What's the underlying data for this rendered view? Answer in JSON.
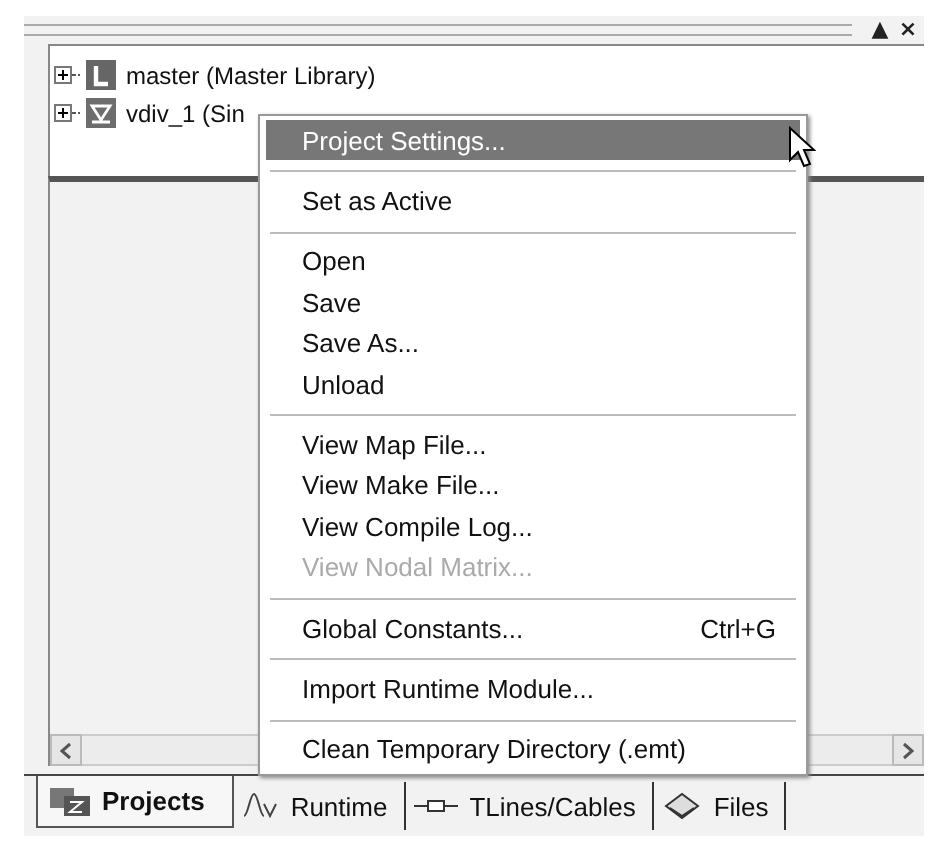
{
  "panel": {
    "header_buttons": [
      "▲",
      "×"
    ]
  },
  "tree": [
    {
      "label": "master (Master Library)",
      "expanded": false
    },
    {
      "label": "vdiv_1 (Sin",
      "expanded": false
    }
  ],
  "context_menu": [
    {
      "kind": "item",
      "label": "Project Settings...",
      "selected": true,
      "disabled": false
    },
    {
      "kind": "separator"
    },
    {
      "kind": "item",
      "label": "Set as Active",
      "selected": false,
      "disabled": false
    },
    {
      "kind": "separator"
    },
    {
      "kind": "item",
      "label": "Open",
      "selected": false,
      "disabled": false
    },
    {
      "kind": "item",
      "label": "Save",
      "selected": false,
      "disabled": false
    },
    {
      "kind": "item",
      "label": "Save As...",
      "selected": false,
      "disabled": false
    },
    {
      "kind": "item",
      "label": "Unload",
      "selected": false,
      "disabled": false
    },
    {
      "kind": "separator"
    },
    {
      "kind": "item",
      "label": "View Map File...",
      "selected": false,
      "disabled": false
    },
    {
      "kind": "item",
      "label": "View Make File...",
      "selected": false,
      "disabled": false
    },
    {
      "kind": "item",
      "label": "View Compile Log...",
      "selected": false,
      "disabled": false
    },
    {
      "kind": "item",
      "label": "View Nodal Matrix...",
      "selected": false,
      "disabled": true
    },
    {
      "kind": "separator"
    },
    {
      "kind": "item",
      "label": "Global Constants...",
      "shortcut": "Ctrl+G",
      "selected": false,
      "disabled": false
    },
    {
      "kind": "separator"
    },
    {
      "kind": "item",
      "label": "Import Runtime Module...",
      "selected": false,
      "disabled": false
    },
    {
      "kind": "separator"
    },
    {
      "kind": "item",
      "label": "Clean Temporary Directory (.emt)",
      "selected": false,
      "disabled": false
    }
  ],
  "tabs": [
    {
      "label": "Projects",
      "selected": true
    },
    {
      "label": "Runtime",
      "selected": false
    },
    {
      "label": "TLines/Cables",
      "selected": false
    },
    {
      "label": "Files",
      "selected": false
    }
  ]
}
